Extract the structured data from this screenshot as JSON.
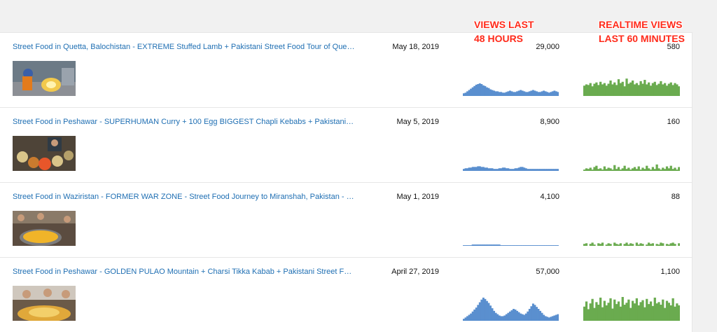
{
  "annotations": {
    "views48_line1": "VIEWS LAST",
    "views48_line2": "48 HOURS",
    "realtime_line1": "REALTIME VIEWS",
    "realtime_line2": "LAST 60 MINUTES"
  },
  "colors": {
    "title_link": "#1f6fb3",
    "spark_48h": "#5a8fcf",
    "spark_realtime": "#6aab4f",
    "annotation": "#ff2a1a"
  },
  "videos": [
    {
      "title": "Street Food in Quetta, Balochistan - EXTREME Stuffed Lamb + Pakistani Street Food Tour of Quetta!",
      "date": "May 18, 2019",
      "views_48h": "29,000",
      "realtime_views": "580",
      "spark_48h": [
        4,
        5,
        7,
        9,
        11,
        13,
        15,
        17,
        18,
        19,
        18,
        16,
        15,
        13,
        12,
        10,
        9,
        8,
        7,
        7,
        6,
        6,
        5,
        5,
        6,
        7,
        8,
        7,
        6,
        6,
        7,
        8,
        9,
        8,
        7,
        6,
        6,
        7,
        8,
        9,
        8,
        7,
        6,
        6,
        7,
        8,
        7,
        6,
        5,
        6,
        7,
        8,
        7,
        6
      ],
      "spark_rt": [
        16,
        18,
        17,
        20,
        15,
        19,
        21,
        17,
        22,
        18,
        20,
        16,
        19,
        24,
        18,
        21,
        17,
        26,
        20,
        22,
        15,
        27,
        19,
        21,
        24,
        18,
        20,
        17,
        23,
        19,
        25,
        18,
        21,
        16,
        20,
        22,
        17,
        19,
        23,
        18,
        20,
        16,
        19,
        21,
        17,
        20,
        18,
        15
      ]
    },
    {
      "title": "Street Food in Peshawar - SUPERHUMAN Curry + 100 Egg BIGGEST Chapli Kebabs + Pakistani Street Food Tour",
      "date": "May 5, 2019",
      "views_48h": "8,900",
      "realtime_views": "160",
      "spark_48h": [
        3,
        4,
        4,
        5,
        5,
        6,
        6,
        6,
        7,
        7,
        6,
        6,
        5,
        5,
        4,
        4,
        4,
        3,
        3,
        3,
        4,
        4,
        5,
        5,
        4,
        4,
        3,
        3,
        3,
        4,
        4,
        5,
        6,
        6,
        5,
        4,
        3,
        3,
        3,
        3,
        3,
        3,
        3,
        3,
        3,
        3,
        3,
        3,
        3,
        3,
        3,
        3,
        3,
        3
      ],
      "spark_rt": [
        2,
        4,
        3,
        5,
        2,
        6,
        8,
        3,
        4,
        2,
        7,
        3,
        5,
        4,
        2,
        9,
        3,
        6,
        2,
        4,
        8,
        3,
        5,
        2,
        4,
        6,
        3,
        7,
        2,
        5,
        3,
        8,
        4,
        2,
        6,
        3,
        10,
        4,
        2,
        5,
        3,
        7,
        4,
        8,
        3,
        5,
        2,
        6
      ]
    },
    {
      "title": "Street Food in Waziristan - FORMER WAR ZONE - Street Food Journey to Miranshah, Pakistan - VERY RARE!",
      "date": "May 1, 2019",
      "views_48h": "4,100",
      "realtime_views": "88",
      "spark_48h": [
        1,
        1,
        1,
        1,
        1,
        2,
        2,
        2,
        2,
        2,
        2,
        2,
        2,
        2,
        2,
        2,
        2,
        2,
        2,
        2,
        2,
        1,
        1,
        1,
        1,
        1,
        1,
        1,
        1,
        1,
        1,
        1,
        1,
        1,
        1,
        1,
        1,
        1,
        1,
        1,
        1,
        1,
        1,
        1,
        1,
        1,
        1,
        1,
        1,
        1,
        1,
        1,
        1,
        1
      ],
      "spark_rt": [
        3,
        4,
        0,
        3,
        5,
        2,
        0,
        4,
        3,
        5,
        0,
        2,
        4,
        3,
        0,
        5,
        3,
        2,
        4,
        0,
        3,
        5,
        2,
        4,
        3,
        0,
        5,
        2,
        4,
        3,
        0,
        2,
        5,
        3,
        4,
        0,
        3,
        2,
        5,
        4,
        0,
        3,
        2,
        4,
        5,
        3,
        0,
        4
      ]
    },
    {
      "title": "Street Food in Peshawar - GOLDEN PULAO Mountain + Charsi Tikka Kabab + Pakistani Street Food Tour",
      "date": "April 27, 2019",
      "views_48h": "57,000",
      "realtime_views": "1,100",
      "spark_48h": [
        3,
        5,
        7,
        9,
        11,
        14,
        17,
        20,
        24,
        28,
        32,
        35,
        33,
        30,
        27,
        23,
        19,
        15,
        12,
        10,
        8,
        7,
        7,
        8,
        10,
        12,
        14,
        16,
        18,
        17,
        15,
        13,
        11,
        10,
        9,
        11,
        14,
        18,
        22,
        26,
        24,
        21,
        18,
        15,
        12,
        9,
        7,
        6,
        5,
        6,
        7,
        8,
        9,
        10
      ],
      "spark_rt": [
        22,
        30,
        18,
        27,
        34,
        20,
        29,
        25,
        36,
        21,
        31,
        24,
        28,
        35,
        19,
        33,
        26,
        30,
        22,
        37,
        25,
        28,
        33,
        20,
        31,
        27,
        35,
        24,
        29,
        32,
        21,
        34,
        26,
        30,
        23,
        36,
        27,
        29,
        25,
        33,
        20,
        31,
        28,
        24,
        35,
        22,
        27,
        24
      ]
    }
  ]
}
